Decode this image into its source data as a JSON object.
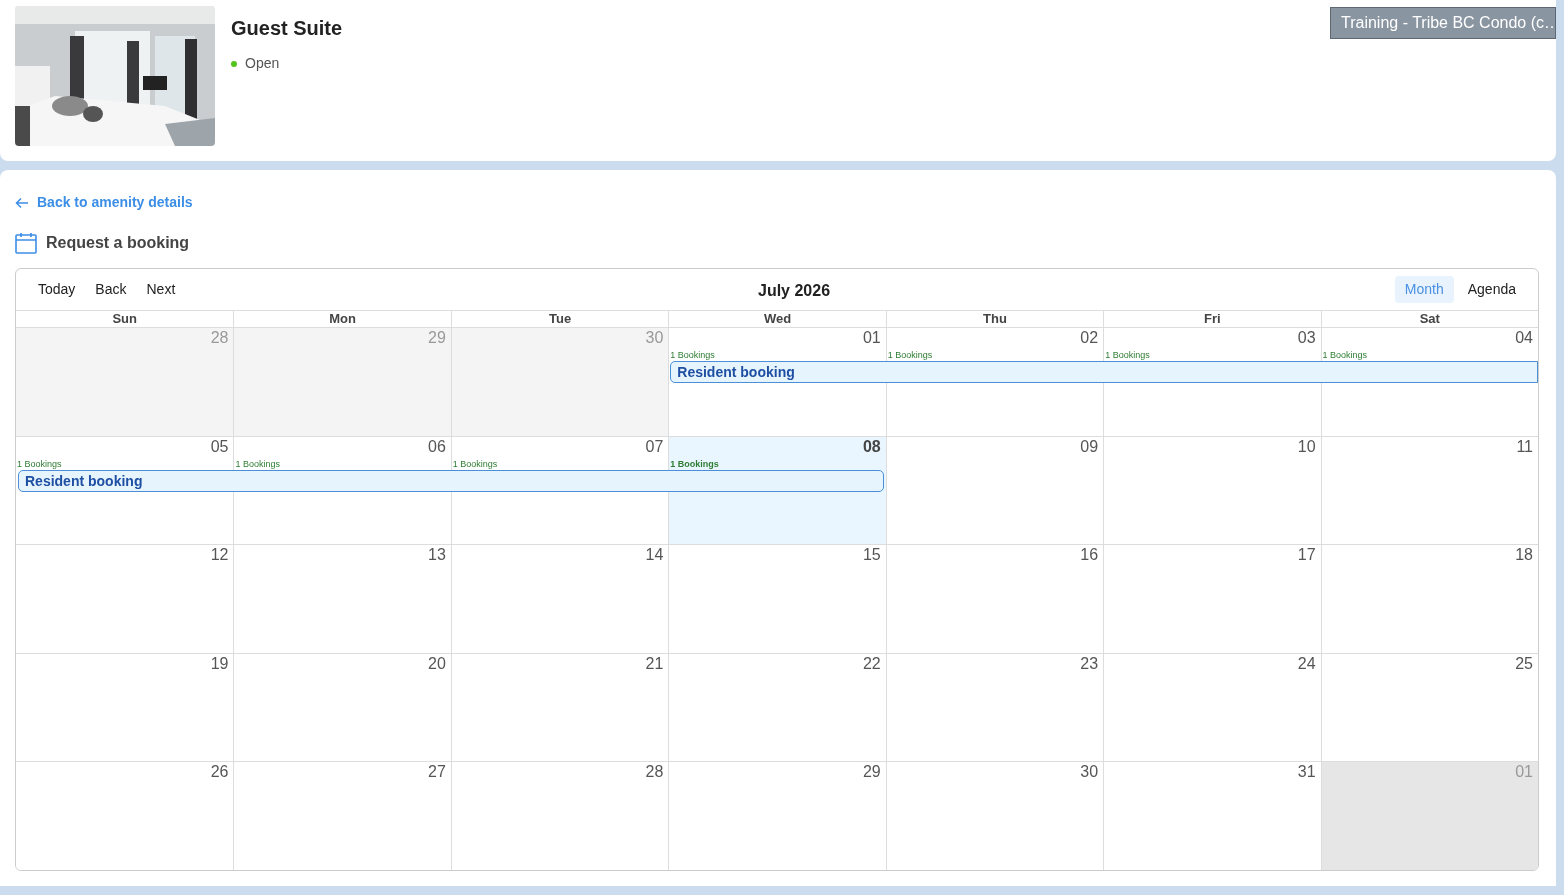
{
  "amenity": {
    "title": "Guest Suite",
    "status": "Open"
  },
  "property_badge": "Training - Tribe BC Condo (c…",
  "back_link": "Back to amenity details",
  "section_title": "Request a booking",
  "calendar": {
    "toolbar": {
      "nav": [
        "Today",
        "Back",
        "Next"
      ],
      "label": "July 2026",
      "views": [
        {
          "label": "Month",
          "selected": true
        },
        {
          "label": "Agenda",
          "selected": false
        }
      ]
    },
    "weekdays": [
      "Sun",
      "Mon",
      "Tue",
      "Wed",
      "Thu",
      "Fri",
      "Sat"
    ],
    "weeks": [
      {
        "days": [
          {
            "date": "28",
            "kind": "outside"
          },
          {
            "date": "29",
            "kind": "outside"
          },
          {
            "date": "30",
            "kind": "outside"
          },
          {
            "date": "01",
            "kind": "current",
            "bookings": "1 Bookings"
          },
          {
            "date": "02",
            "kind": "current",
            "bookings": "1 Bookings"
          },
          {
            "date": "03",
            "kind": "current",
            "bookings": "1 Bookings"
          },
          {
            "date": "04",
            "kind": "current",
            "bookings": "1 Bookings"
          }
        ],
        "events": [
          "Resident booking"
        ]
      },
      {
        "days": [
          {
            "date": "05",
            "kind": "current",
            "bookings": "1 Bookings"
          },
          {
            "date": "06",
            "kind": "current",
            "bookings": "1 Bookings"
          },
          {
            "date": "07",
            "kind": "current",
            "bookings": "1 Bookings"
          },
          {
            "date": "08",
            "kind": "today",
            "bookings": "1 Bookings"
          },
          {
            "date": "09",
            "kind": "current"
          },
          {
            "date": "10",
            "kind": "current"
          },
          {
            "date": "11",
            "kind": "current"
          }
        ],
        "events": [
          "Resident booking"
        ]
      },
      {
        "days": [
          {
            "date": "12",
            "kind": "current"
          },
          {
            "date": "13",
            "kind": "current"
          },
          {
            "date": "14",
            "kind": "current"
          },
          {
            "date": "15",
            "kind": "current"
          },
          {
            "date": "16",
            "kind": "current"
          },
          {
            "date": "17",
            "kind": "current"
          },
          {
            "date": "18",
            "kind": "current"
          }
        ]
      },
      {
        "days": [
          {
            "date": "19",
            "kind": "current"
          },
          {
            "date": "20",
            "kind": "current"
          },
          {
            "date": "21",
            "kind": "current"
          },
          {
            "date": "22",
            "kind": "current"
          },
          {
            "date": "23",
            "kind": "current"
          },
          {
            "date": "24",
            "kind": "current"
          },
          {
            "date": "25",
            "kind": "current"
          }
        ]
      },
      {
        "days": [
          {
            "date": "26",
            "kind": "current"
          },
          {
            "date": "27",
            "kind": "current"
          },
          {
            "date": "28",
            "kind": "current"
          },
          {
            "date": "29",
            "kind": "current"
          },
          {
            "date": "30",
            "kind": "current"
          },
          {
            "date": "31",
            "kind": "current"
          },
          {
            "date": "01",
            "kind": "highlighted"
          }
        ]
      }
    ]
  }
}
